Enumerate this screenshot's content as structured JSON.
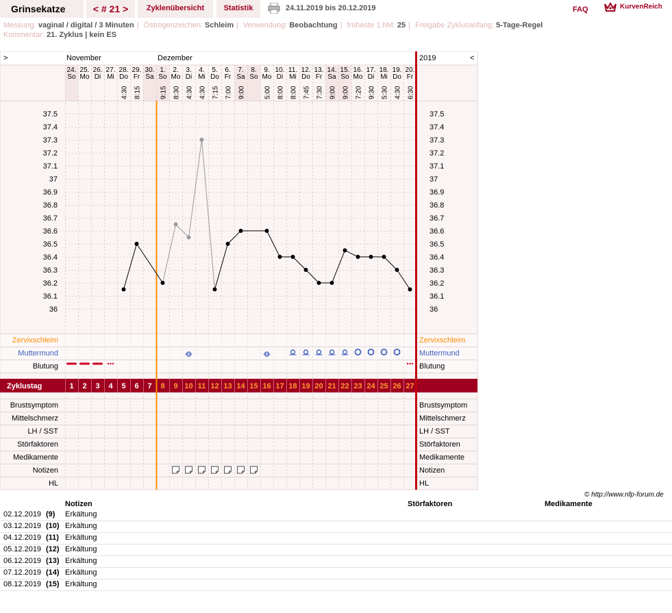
{
  "app": {
    "title": "Grinsekatze",
    "cycle_nav": "< # 21 >",
    "tab_overview": "Zyklenübersicht",
    "tab_stats": "Statistik",
    "date_range": "24.11.2019 bis 20.12.2019",
    "faq": "FAQ",
    "brand": "KurvenReich"
  },
  "meta": {
    "messung_label": "Messung:",
    "messung": "vaginal / digital / 3 Minuten",
    "oestrogen_label": "Östrogenzeichen:",
    "oestrogen": "Schleim",
    "verwendung_label": "Verwendung:",
    "verwendung": "Beobachtung",
    "hm_label": "früheste 1.hM:",
    "hm": "25",
    "freigabe_label": "Freigabe Zyklusanfang:",
    "freigabe": "5-Tage-Regel",
    "kommentar_label": "Kommentar:",
    "kommentar": "21. Zyklus | kein ES"
  },
  "chart_data": {
    "type": "line",
    "title": "",
    "corner_left": ">",
    "corner_right": "<",
    "year": "2019",
    "months": [
      {
        "label": "November",
        "day_index": 0
      },
      {
        "label": "Dezember",
        "day_index": 7
      }
    ],
    "dates": [
      "24.",
      "25.",
      "26.",
      "27.",
      "28.",
      "29.",
      "30.",
      "1.",
      "2.",
      "3.",
      "4.",
      "5.",
      "6.",
      "7.",
      "8.",
      "9.",
      "10.",
      "11.",
      "12.",
      "13.",
      "14.",
      "15.",
      "16.",
      "17.",
      "18.",
      "19.",
      "20."
    ],
    "weekdays": [
      "So",
      "Mo",
      "Di",
      "Mi",
      "Do",
      "Fr",
      "Sa",
      "So",
      "Mo",
      "Di",
      "Mi",
      "Do",
      "Fr",
      "Sa",
      "So",
      "Mo",
      "Di",
      "Mi",
      "Do",
      "Fr",
      "Sa",
      "So",
      "Mo",
      "Di",
      "Mi",
      "Do",
      "Fr"
    ],
    "times": [
      "",
      "",
      "",
      "",
      "4:30",
      "8:15",
      "",
      "9:15",
      "8:30",
      "4:30",
      "4:30",
      "7:15",
      "7:00",
      "9:00",
      "",
      "5:00",
      "8:00",
      "8:00",
      "7:45",
      "7:30",
      "9:00",
      "9:00",
      "7:20",
      "9:30",
      "5:30",
      "4:30",
      "6:30"
    ],
    "cycle_days": [
      1,
      2,
      3,
      4,
      5,
      6,
      7,
      8,
      9,
      10,
      11,
      12,
      13,
      14,
      15,
      16,
      17,
      18,
      19,
      20,
      21,
      22,
      23,
      24,
      25,
      26,
      27
    ],
    "temperatures": [
      null,
      null,
      null,
      null,
      36.15,
      36.5,
      null,
      36.2,
      36.65,
      36.55,
      37.3,
      36.15,
      36.5,
      36.6,
      null,
      36.6,
      36.4,
      36.4,
      36.3,
      36.2,
      36.2,
      36.45,
      36.4,
      36.4,
      36.4,
      36.3,
      36.15
    ],
    "excluded": [
      false,
      false,
      false,
      false,
      false,
      false,
      false,
      false,
      true,
      true,
      true,
      false,
      false,
      false,
      false,
      false,
      false,
      false,
      false,
      false,
      false,
      false,
      false,
      false,
      false,
      false,
      false
    ],
    "ylim": [
      36.0,
      37.5
    ],
    "yticks": [
      "37.5",
      "37.4",
      "37.3",
      "37.2",
      "37.1",
      "37",
      "36.9",
      "36.8",
      "36.7",
      "36.6",
      "36.5",
      "36.4",
      "36.3",
      "36.2",
      "36.1",
      "36"
    ],
    "coverline_after_day_index": 6,
    "muttermund": [
      "",
      "",
      "",
      "",
      "",
      "",
      "",
      "",
      "",
      "closed-low",
      "",
      "",
      "",
      "",
      "",
      "closed-low",
      "",
      "open-low",
      "open-low",
      "open-low",
      "open-low",
      "open-low",
      "open-mid",
      "open-mid",
      "open-mid",
      "open-mid",
      ""
    ],
    "blutung": [
      "strong",
      "strong",
      "strong",
      "spotting",
      "",
      "",
      "",
      "",
      "",
      "",
      "",
      "",
      "",
      "",
      "",
      "",
      "",
      "",
      "",
      "",
      "",
      "",
      "",
      "",
      "",
      "",
      "spotting"
    ],
    "notizen": [
      false,
      false,
      false,
      false,
      false,
      false,
      false,
      false,
      true,
      true,
      true,
      true,
      true,
      true,
      true,
      false,
      false,
      false,
      false,
      false,
      false,
      false,
      false,
      false,
      false,
      false,
      false
    ],
    "rows_top": [
      "Zervixschleim",
      "Muttermund",
      "Blutung"
    ],
    "zyklustag_label": "Zyklustag",
    "rows_bottom": [
      "Brustsymptom",
      "Mittelschmerz",
      "LH / SST",
      "Störfaktoren",
      "Medikamente",
      "Notizen",
      "HL"
    ],
    "colors": {
      "accent": "#a00020",
      "zervix": "#ff8c00",
      "muttermund": "#4060c0",
      "grid_bg": "#fbf4f4",
      "weekend": "#f5e6e6"
    }
  },
  "notes": {
    "copyright": "© http://www.nfp-forum.de",
    "header_notizen": "Notizen",
    "header_stoer": "Störfaktoren",
    "header_med": "Medikamente",
    "rows": [
      {
        "date": "02.12.2019",
        "day": "(9)",
        "text": "Erkältung"
      },
      {
        "date": "03.12.2019",
        "day": "(10)",
        "text": "Erkältung"
      },
      {
        "date": "04.12.2019",
        "day": "(11)",
        "text": "Erkältung"
      },
      {
        "date": "05.12.2019",
        "day": "(12)",
        "text": "Erkältung"
      },
      {
        "date": "06.12.2019",
        "day": "(13)",
        "text": "Erkältung"
      },
      {
        "date": "07.12.2019",
        "day": "(14)",
        "text": "Erkältung"
      },
      {
        "date": "08.12.2019",
        "day": "(15)",
        "text": "Erkältung"
      }
    ]
  }
}
